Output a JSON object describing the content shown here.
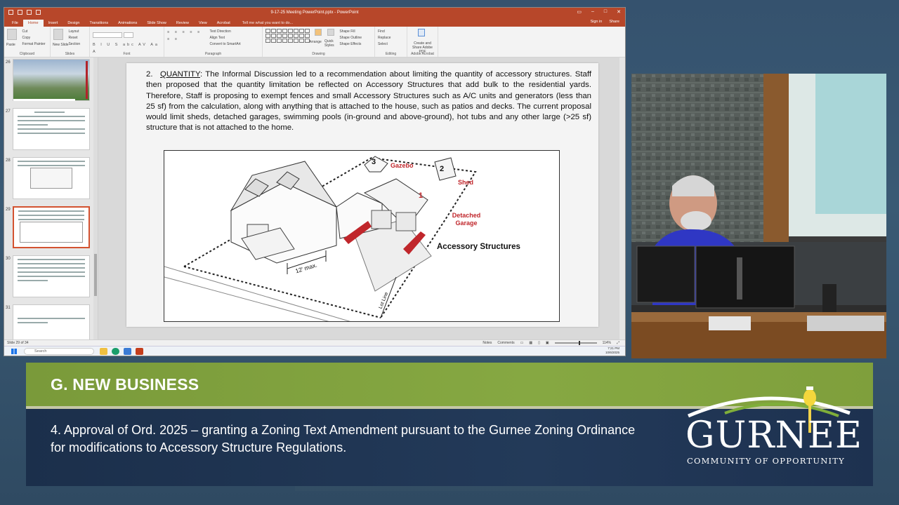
{
  "powerpoint": {
    "title": "9-17-25 Meeting PowerPoint.pptx - PowerPoint",
    "tabs": [
      "File",
      "Home",
      "Insert",
      "Design",
      "Transitions",
      "Animations",
      "Slide Show",
      "Review",
      "View",
      "Acrobat"
    ],
    "active_tab": "Home",
    "tell_me": "Tell me what you want to do...",
    "sign_in": "Sign in",
    "share": "Share",
    "ribbon": {
      "clipboard": {
        "label": "Clipboard",
        "paste": "Paste",
        "cut": "Cut",
        "copy": "Copy",
        "format_painter": "Format Painter"
      },
      "slides": {
        "label": "Slides",
        "new_slide": "New Slide",
        "layout": "Layout",
        "reset": "Reset",
        "section": "Section"
      },
      "font": {
        "label": "Font"
      },
      "paragraph": {
        "label": "Paragraph",
        "text_direction": "Text Direction",
        "align_text": "Align Text",
        "smartart": "Convert to SmartArt"
      },
      "drawing": {
        "label": "Drawing",
        "arrange": "Arrange",
        "quick_styles": "Quick Styles",
        "shape_fill": "Shape Fill",
        "shape_outline": "Shape Outline",
        "shape_effects": "Shape Effects"
      },
      "editing": {
        "label": "Editing",
        "find": "Find",
        "replace": "Replace",
        "select": "Select"
      },
      "acrobat": {
        "label": "Adobe Acrobat",
        "create_share": "Create and Share Adobe PDF"
      }
    },
    "thumbnails": [
      {
        "number": "26"
      },
      {
        "number": "27"
      },
      {
        "number": "28"
      },
      {
        "number": "29",
        "selected": true
      },
      {
        "number": "30"
      },
      {
        "number": "31"
      }
    ],
    "slide": {
      "item_number": "2.",
      "keyword": "QUANTITY",
      "paragraph": ": The Informal Discussion led to a recommendation about limiting the quantity of accessory structures. Staff then proposed that the quantity limitation be reflected on Accessory Structures that add bulk to the residential yards. Therefore, Staff is proposing to exempt fences and small Accessory Structures such as A/C units and generators (less than 25 sf) from the calculation, along with anything that is attached to the house, such as patios and decks. The current proposal would limit sheds, detached garages, swimming pools (in-ground and above-ground), hot tubs and any other large (>25 sf) structure that is not attached to the home.",
      "figure": {
        "gazebo": "Gazebo",
        "shed": "Shed",
        "detached_garage": "Detached Garage",
        "caption": "Accessory Structures",
        "dimension": "12' max.",
        "lot_line": "Lot Line",
        "markers": [
          "1",
          "2",
          "3"
        ]
      }
    },
    "status": {
      "slide_counter": "Slide 29 of 34",
      "notes": "Notes",
      "comments": "Comments",
      "zoom": "114%"
    },
    "taskbar": {
      "search_placeholder": "Search",
      "time": "7:21 PM",
      "date": "10/6/2025"
    }
  },
  "lower_third": {
    "section": "G.  NEW BUSINESS",
    "agenda_item": "4. Approval of Ord. 2025 –     granting a Zoning Text Amendment pursuant to the Gurnee Zoning Ordinance for modifications to Accessory Structure Regulations.",
    "logo_main": "GURNEE",
    "logo_tagline": "COMMUNITY OF OPPORTUNITY"
  },
  "colors": {
    "ppt_accent": "#b7472a",
    "lower_green": "#86a842",
    "lower_navy": "#1d3150",
    "figure_red": "#c0262b"
  }
}
